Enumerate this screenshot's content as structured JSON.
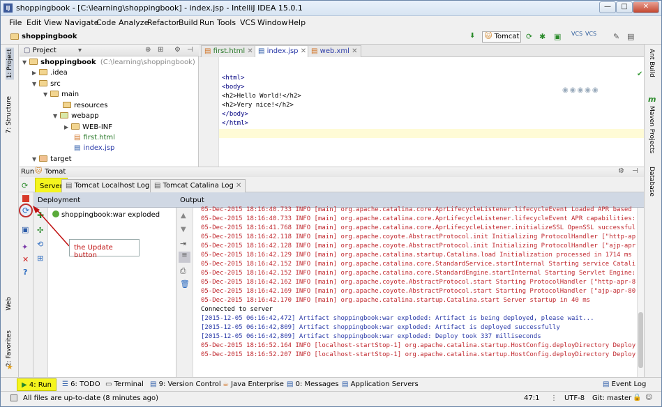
{
  "window": {
    "title": "shoppingbook - [C:\\learning\\shoppingbook] - index.jsp - IntelliJ IDEA 15.0.1",
    "minimize": "—",
    "maximize": "□",
    "close": "✕"
  },
  "menu": [
    "File",
    "Edit",
    "View",
    "Navigate",
    "Code",
    "Analyze",
    "Refactor",
    "Build",
    "Run",
    "Tools",
    "VCS",
    "Window",
    "Help"
  ],
  "navbar": {
    "breadcrumb": "shoppingbook",
    "run_config": "Tomcat"
  },
  "left_strip": {
    "project": "1: Project",
    "structure": "7: Structure",
    "web": "Web",
    "favorites": "2: Favorites"
  },
  "right_strip": {
    "ant": "Ant Build",
    "maven": "Maven Projects",
    "database": "Database"
  },
  "project": {
    "header": "Project",
    "root_name": "shoppingbook",
    "root_path": "(C:\\learning\\shoppingbook)",
    "items": [
      ".idea",
      "src",
      "main",
      "resources",
      "webapp",
      "WEB-INF",
      "first.html",
      "index.jsp",
      "target"
    ]
  },
  "editor": {
    "tabs": [
      "first.html",
      "index.jsp",
      "web.xml"
    ],
    "lines": [
      "<html>",
      "<body>",
      "<h2>Hello World!</h2>",
      "<h2>Very nice!</h2>",
      "</body>",
      "</html>"
    ]
  },
  "run": {
    "header_label": "Run",
    "config": "Tomat",
    "tabs": [
      "Server",
      "Tomcat Localhost Log",
      "Tomcat Catalina Log"
    ],
    "deployment_header": "Deployment",
    "deployment_item": "shoppingbook:war exploded",
    "output_header": "Output",
    "log": [
      {
        "c": "red",
        "t": "05-Dec-2015 18:16:40.733 INFO [main] org.apache.catalina.core.AprLifecycleListener.lifecycleEvent Loaded APR based"
      },
      {
        "c": "red",
        "t": "05-Dec-2015 18:16:40.733 INFO [main] org.apache.catalina.core.AprLifecycleListener.lifecycleEvent APR capabilities:"
      },
      {
        "c": "red",
        "t": "05-Dec-2015 18:16:41.768 INFO [main] org.apache.catalina.core.AprLifecycleListener.initializeSSL OpenSSL successful"
      },
      {
        "c": "red",
        "t": "05-Dec-2015 18:16:42.118 INFO [main] org.apache.coyote.AbstractProtocol.init Initializing ProtocolHandler [\"http-ap"
      },
      {
        "c": "red",
        "t": "05-Dec-2015 18:16:42.128 INFO [main] org.apache.coyote.AbstractProtocol.init Initializing ProtocolHandler [\"ajp-apr"
      },
      {
        "c": "red",
        "t": "05-Dec-2015 18:16:42.129 INFO [main] org.apache.catalina.startup.Catalina.load Initialization processed in 1714 ms"
      },
      {
        "c": "red",
        "t": "05-Dec-2015 18:16:42.152 INFO [main] org.apache.catalina.core.StandardService.startInternal Starting service Catali"
      },
      {
        "c": "red",
        "t": "05-Dec-2015 18:16:42.152 INFO [main] org.apache.catalina.core.StandardEngine.startInternal Starting Servlet Engine:"
      },
      {
        "c": "red",
        "t": "05-Dec-2015 18:16:42.162 INFO [main] org.apache.coyote.AbstractProtocol.start Starting ProtocolHandler [\"http-apr-8"
      },
      {
        "c": "red",
        "t": "05-Dec-2015 18:16:42.169 INFO [main] org.apache.coyote.AbstractProtocol.start Starting ProtocolHandler [\"ajp-apr-80"
      },
      {
        "c": "red",
        "t": "05-Dec-2015 18:16:42.170 INFO [main] org.apache.catalina.startup.Catalina.start Server startup in 40 ms"
      },
      {
        "c": "blk",
        "t": "Connected to server"
      },
      {
        "c": "blue",
        "t": "[2015-12-05 06:16:42,472] Artifact shoppingbook:war exploded: Artifact is being deployed, please wait..."
      },
      {
        "c": "blue",
        "t": "[2015-12-05 06:16:42,809] Artifact shoppingbook:war exploded: Artifact is deployed successfully"
      },
      {
        "c": "blue",
        "t": "[2015-12-05 06:16:42,809] Artifact shoppingbook:war exploded: Deploy took 337 milliseconds"
      },
      {
        "c": "red",
        "t": "05-Dec-2015 18:16:52.164 INFO [localhost-startStop-1] org.apache.catalina.startup.HostConfig.deployDirectory Deploy"
      },
      {
        "c": "red",
        "t": "05-Dec-2015 18:16:52.207 INFO [localhost-startStop-1] org.apache.catalina.startup.HostConfig.deployDirectory Deploy"
      }
    ]
  },
  "annotation": "the Update button",
  "bottom_tools": [
    {
      "key": "4",
      "label": "4: Run"
    },
    {
      "key": "6",
      "label": "6: TODO"
    },
    {
      "key": "",
      "label": "Terminal"
    },
    {
      "key": "9",
      "label": "9: Version Control"
    },
    {
      "key": "",
      "label": "Java Enterprise"
    },
    {
      "key": "0",
      "label": "0: Messages"
    },
    {
      "key": "",
      "label": "Application Servers"
    },
    {
      "key": "",
      "label": "Event Log"
    }
  ],
  "status": {
    "message": "All files are up-to-date (8 minutes ago)",
    "position": "47:1",
    "encoding": "UTF-8",
    "git": "Git: master"
  },
  "colors": {
    "highlight": "#f5f51e",
    "log_red": "#c0272d",
    "log_blue": "#2a3aa8",
    "annotation_red": "#c01010"
  }
}
